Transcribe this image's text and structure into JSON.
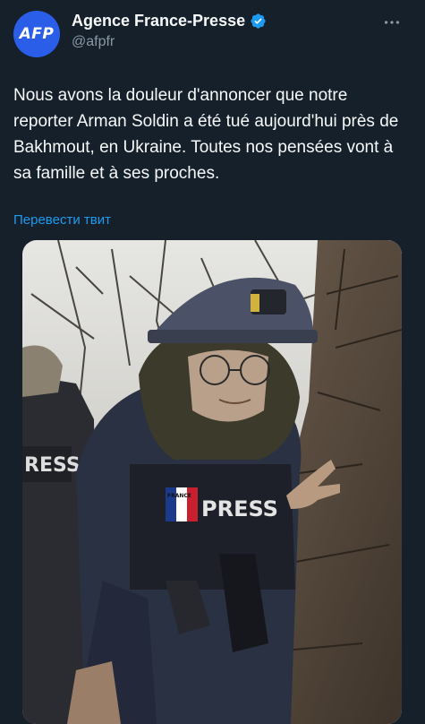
{
  "tweet": {
    "avatar_text": "AFP",
    "display_name": "Agence France-Presse",
    "handle": "@afpfr",
    "verified": true,
    "text": "Nous avons la douleur d'annoncer que notre reporter Arman Soldin a été tué aujourd'hui près de Bakhmout, en Ukraine. Toutes nos pensées vont à sa famille et à ses proches.",
    "translate_label": "Перевести твит"
  },
  "media": {
    "vest_label": "PRESS",
    "left_vest_label": "RESS",
    "flag_label": "FRANCE"
  },
  "colors": {
    "background": "#15202b",
    "accent": "#1d9bf0",
    "avatar": "#2a5ee8",
    "text_primary": "#f7f9f9",
    "text_secondary": "#8b98a5"
  }
}
